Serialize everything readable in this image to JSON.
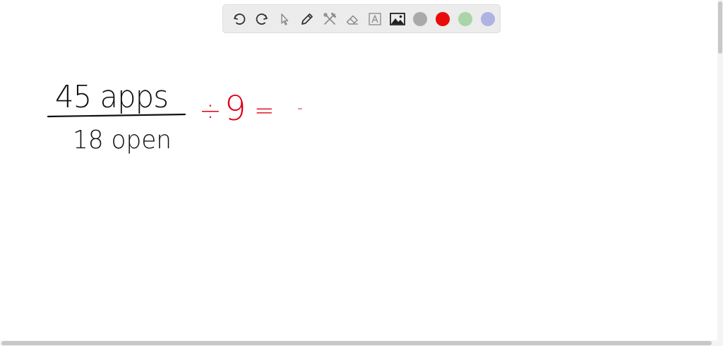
{
  "toolbar": {
    "tools": [
      {
        "name": "undo-button",
        "icon": "undo-icon"
      },
      {
        "name": "redo-button",
        "icon": "redo-icon"
      },
      {
        "name": "select-tool-button",
        "icon": "cursor-icon"
      },
      {
        "name": "pen-tool-button",
        "icon": "pencil-icon"
      },
      {
        "name": "tools-button",
        "icon": "tools-icon"
      },
      {
        "name": "eraser-button",
        "icon": "eraser-icon"
      },
      {
        "name": "text-tool-button",
        "icon": "text-icon"
      },
      {
        "name": "image-button",
        "icon": "image-icon"
      }
    ],
    "colors": [
      "#a9a9a9",
      "#ea0a0a",
      "#a9d5a9",
      "#aeb3e3"
    ]
  },
  "canvas": {
    "numerator": "45 apps",
    "denominator": "18 open",
    "operator": "÷",
    "divisor": "9",
    "equals": "=",
    "trailing_mark": "-",
    "black_ink": "#111111",
    "red_ink": "#e00018"
  }
}
